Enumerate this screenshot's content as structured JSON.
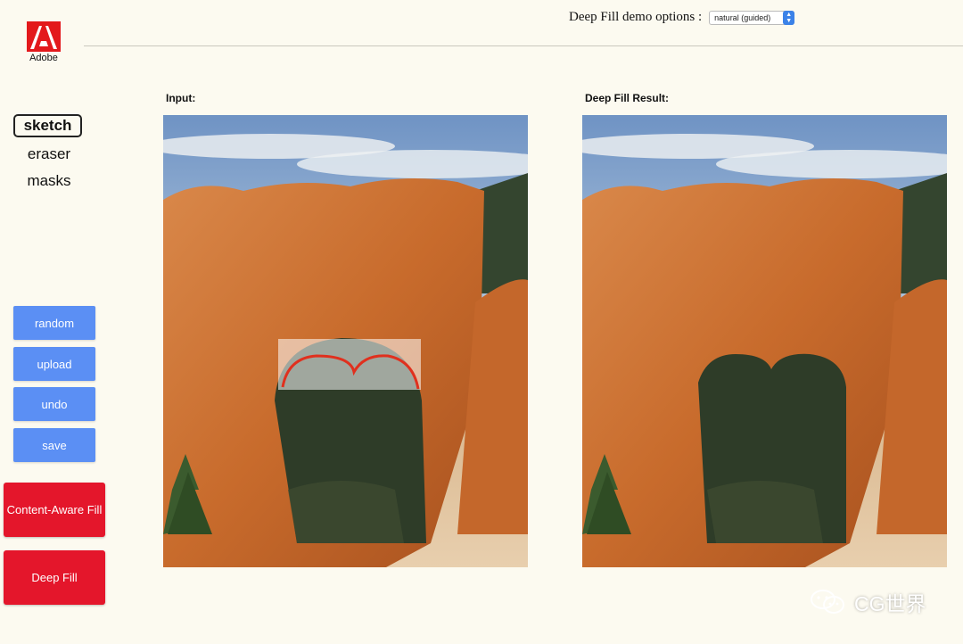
{
  "brand": {
    "logo_text": "Adobe",
    "icon": "adobe-logo-icon",
    "color": "#e3191c"
  },
  "header": {
    "options_label": "Deep Fill demo options :",
    "options_select": {
      "value": "natural (guided)",
      "icon": "select-arrows-icon"
    }
  },
  "tools": {
    "items": [
      {
        "label": "sketch",
        "active": true
      },
      {
        "label": "eraser"
      },
      {
        "label": "masks"
      }
    ]
  },
  "buttons": {
    "random": "random",
    "upload": "upload",
    "undo": "undo",
    "save": "save",
    "content_aware_fill": "Content-Aware Fill",
    "deep_fill": "Deep Fill"
  },
  "panels": {
    "input_label": "Input:",
    "result_label": "Deep Fill Result:"
  },
  "watermark": {
    "text": "CG世界",
    "icon": "wechat-icon"
  },
  "colors": {
    "accent_blue": "#5b8ff4",
    "action_red": "#e4162b",
    "sketch_stroke": "#e0301e"
  }
}
